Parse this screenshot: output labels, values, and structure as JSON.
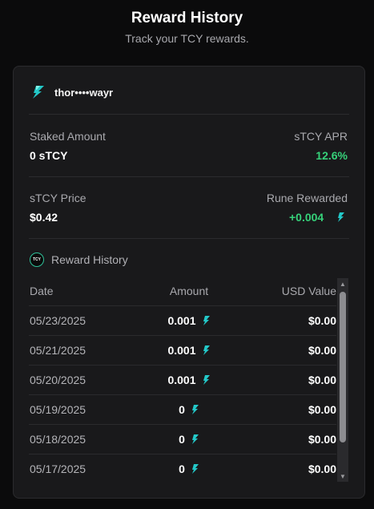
{
  "header": {
    "title": "Reward History",
    "subtitle": "Track your TCY rewards."
  },
  "account": {
    "icon": "thorchain-bolt-icon",
    "name": "thor••••wayr"
  },
  "stats": {
    "staked_label": "Staked Amount",
    "staked_value": "0 sTCY",
    "apr_label": "sTCY APR",
    "apr_value": "12.6%",
    "price_label": "sTCY Price",
    "price_value": "$0.42",
    "rune_label": "Rune Rewarded",
    "rune_value": "+0.004"
  },
  "reward_history": {
    "icon": "tcy-logo-icon",
    "logo_text": "TCY",
    "title": "Reward History",
    "columns": [
      "Date",
      "Amount",
      "USD Value"
    ],
    "rows": [
      {
        "date": "05/23/2025",
        "amount": "0.001",
        "usd": "$0.00"
      },
      {
        "date": "05/21/2025",
        "amount": "0.001",
        "usd": "$0.00"
      },
      {
        "date": "05/20/2025",
        "amount": "0.001",
        "usd": "$0.00"
      },
      {
        "date": "05/19/2025",
        "amount": "0",
        "usd": "$0.00"
      },
      {
        "date": "05/18/2025",
        "amount": "0",
        "usd": "$0.00"
      },
      {
        "date": "05/17/2025",
        "amount": "0",
        "usd": "$0.00"
      }
    ]
  },
  "colors": {
    "background": "#0b0b0c",
    "card": "#19191b",
    "positive": "#36d27a",
    "bolt_teal": "#23c8c8"
  }
}
